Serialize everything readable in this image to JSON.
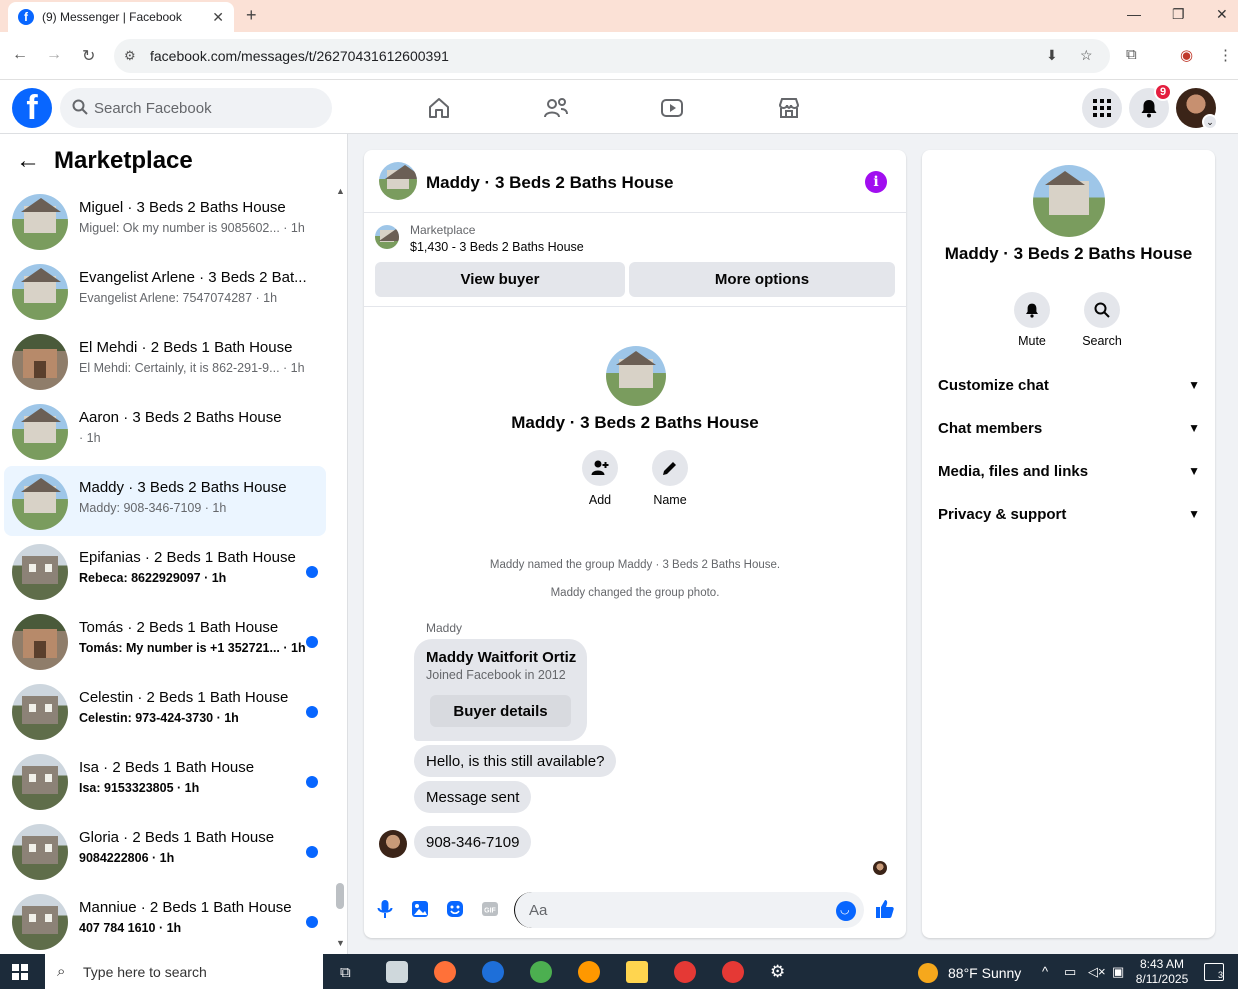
{
  "browser": {
    "tab_title": "(9) Messenger | Facebook",
    "url": "facebook.com/messages/t/26270431612600391"
  },
  "fb": {
    "search_placeholder": "Search Facebook",
    "notification_count": "9"
  },
  "sidebar": {
    "title": "Marketplace",
    "conversations": [
      {
        "name": "Miguel · 3 Beds 2 Baths House",
        "preview": "Miguel: Ok my number is 9085602... · 1h",
        "unread": false,
        "active": false,
        "thumb": "a"
      },
      {
        "name": "Evangelist Arlene · 3 Beds 2 Bat...",
        "preview": "Evangelist Arlene: 7547074287 · 1h",
        "unread": false,
        "active": false,
        "thumb": "a"
      },
      {
        "name": "El Mehdi · 2 Beds 1 Bath House",
        "preview": "El Mehdi: Certainly, it is 862-291-9... · 1h",
        "unread": false,
        "active": false,
        "thumb": "b"
      },
      {
        "name": "Aaron · 3 Beds 2 Baths House",
        "preview": " · 1h",
        "unread": false,
        "active": false,
        "thumb": "a"
      },
      {
        "name": "Maddy · 3 Beds 2 Baths House",
        "preview": "Maddy: 908-346-7109 · 1h",
        "unread": false,
        "active": true,
        "thumb": "a"
      },
      {
        "name": "Epifanias · 2 Beds 1 Bath House",
        "preview": "Rebeca: 8622929097 · 1h",
        "unread": true,
        "active": false,
        "thumb": "c"
      },
      {
        "name": "Tomás · 2 Beds 1 Bath House",
        "preview": "Tomás: My number is +1 352721... · 1h",
        "unread": true,
        "active": false,
        "thumb": "b"
      },
      {
        "name": "Celestin · 2 Beds 1 Bath House",
        "preview": "Celestin: 973-424-3730 · 1h",
        "unread": true,
        "active": false,
        "thumb": "c"
      },
      {
        "name": "Isa · 2 Beds 1 Bath House",
        "preview": "Isa: 9153323805 · 1h",
        "unread": true,
        "active": false,
        "thumb": "c"
      },
      {
        "name": "Gloria · 2 Beds 1 Bath House",
        "preview": "9084222806 · 1h",
        "unread": true,
        "active": false,
        "thumb": "c"
      },
      {
        "name": "Manniue · 2 Beds 1 Bath House",
        "preview": "407 784 1610 · 1h",
        "unread": true,
        "active": false,
        "thumb": "c"
      }
    ]
  },
  "chat": {
    "title": "Maddy · 3 Beds 2 Baths House",
    "marketplace_label": "Marketplace",
    "listing": "$1,430 - 3 Beds 2 Baths House",
    "view_buyer": "View buyer",
    "more_options": "More options",
    "actions": {
      "add": "Add",
      "name": "Name"
    },
    "system_messages": [
      "Maddy named the group Maddy · 3 Beds 2 Baths House.",
      "Maddy changed the group photo."
    ],
    "sender": "Maddy",
    "profile_card": {
      "name": "Maddy Waitforit Ortiz",
      "joined": "Joined Facebook in 2012",
      "button": "Buyer details"
    },
    "messages": [
      "Hello, is this still available?",
      "Message sent",
      "908-346-7109"
    ],
    "composer_placeholder": "Aa"
  },
  "info_panel": {
    "title": "Maddy · 3 Beds 2 Baths House",
    "mute": "Mute",
    "search": "Search",
    "sections": [
      "Customize chat",
      "Chat members",
      "Media, files and links",
      "Privacy & support"
    ]
  },
  "taskbar": {
    "search_placeholder": "Type here to search",
    "weather": "88°F  Sunny",
    "time": "8:43 AM",
    "date": "8/11/2025",
    "notif_count": "3"
  },
  "colors": {
    "fb_blue": "#0866ff",
    "info_purple": "#a10ef0",
    "active_row": "#ebf5ff"
  }
}
